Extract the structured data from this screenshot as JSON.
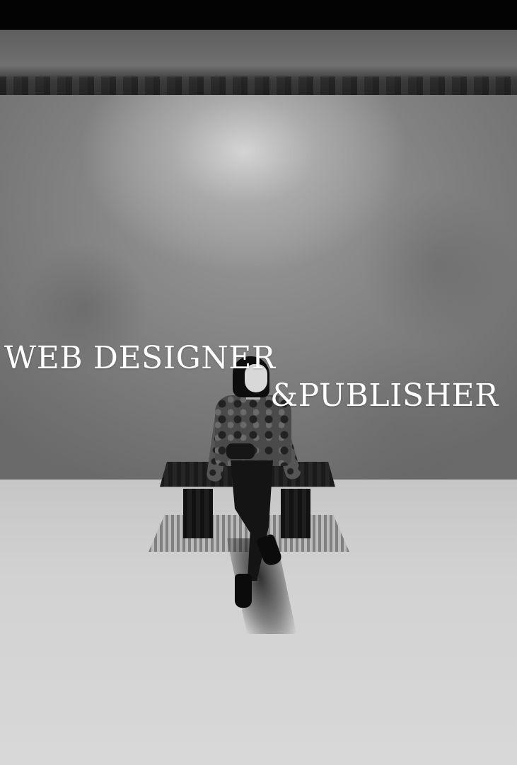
{
  "hero": {
    "headline_line1": "WEB DESIGNER",
    "headline_line2": "&PUBLISHER"
  },
  "colors": {
    "headline": "#ffffff",
    "top_bar": "#030303",
    "wall": "#7d7d7d",
    "floor": "#d2d2d2"
  }
}
